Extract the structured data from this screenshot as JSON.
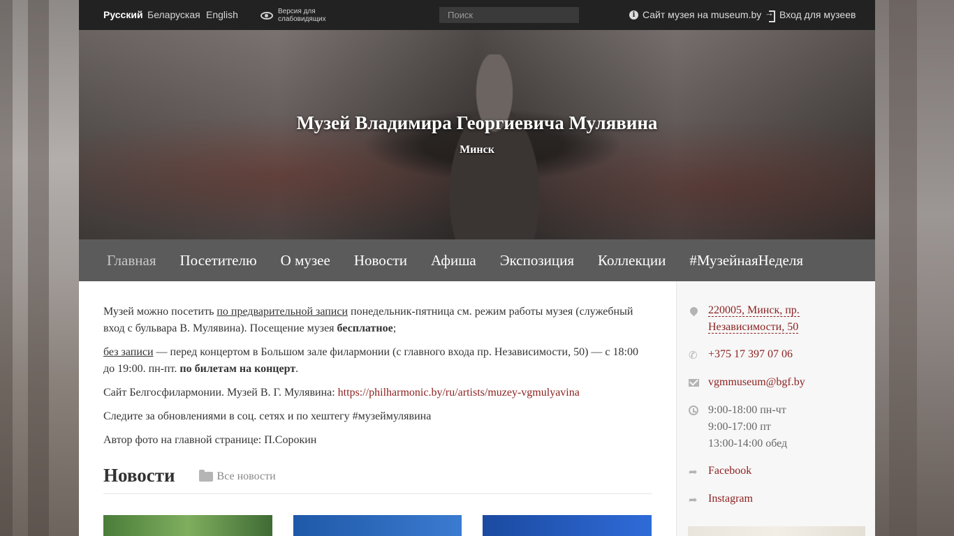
{
  "topbar": {
    "languages": [
      {
        "label": "Русский",
        "active": true
      },
      {
        "label": "Беларуская",
        "active": false
      },
      {
        "label": "English",
        "active": false
      }
    ],
    "vision_mode_label": "Версия для слабовидящих",
    "search_placeholder": "Поиск",
    "museum_site_link": "Сайт музея на museum.by",
    "login_link": "Вход для музеев"
  },
  "hero": {
    "title": "Музей Владимира Георгиевича Мулявина",
    "city": "Минск"
  },
  "nav": {
    "items": [
      {
        "label": "Главная",
        "active": true
      },
      {
        "label": "Посетителю",
        "active": false
      },
      {
        "label": "О музее",
        "active": false
      },
      {
        "label": "Новости",
        "active": false
      },
      {
        "label": "Афиша",
        "active": false
      },
      {
        "label": "Экспозиция",
        "active": false
      },
      {
        "label": "Коллекции",
        "active": false
      },
      {
        "label": "#МузейнаяНеделя",
        "active": false
      }
    ]
  },
  "main": {
    "p1": {
      "t1": "Музей можно посетить ",
      "link": "по предварительной записи",
      "t2": " понедельник-пятница см. режим работы музея (служебный вход с бульвара В. Мулявина). Посещение музея ",
      "bold": "бесплатное",
      "t3": ";"
    },
    "p2": {
      "link": "без записи",
      "t1": " — перед концертом в Большом зале филармонии (с главного входа пр. Независимости, 50) — с 18:00 до 19:00. пн-пт. ",
      "bold": "по билетам на концерт",
      "t2": "."
    },
    "p3": {
      "t1": "Сайт Белгосфилармонии. Музей В. Г. Мулявина: ",
      "link": "https://philharmonic.by/ru/artists/muzey-vgmulyavina"
    },
    "p4": "Следите за обновлениями в соц. сетях и по хештегу #музеймулявина",
    "p5": "Автор фото на главной странице: П.Сорокин",
    "news_title": "Новости",
    "all_news": "Все новости"
  },
  "sidebar": {
    "address": "220005, Минск, пр. Независимости, 50",
    "phone": "+375 17 397 07 06",
    "email": "vgmmuseum@bgf.by",
    "hours": [
      "9:00-18:00 пн-чт",
      "9:00-17:00 пт",
      "13:00-14:00 обед"
    ],
    "facebook": "Facebook",
    "instagram": "Instagram"
  },
  "colors": {
    "topbar": "#222222",
    "nav": "#5b5b5b",
    "link_red": "#8b1f1f"
  }
}
